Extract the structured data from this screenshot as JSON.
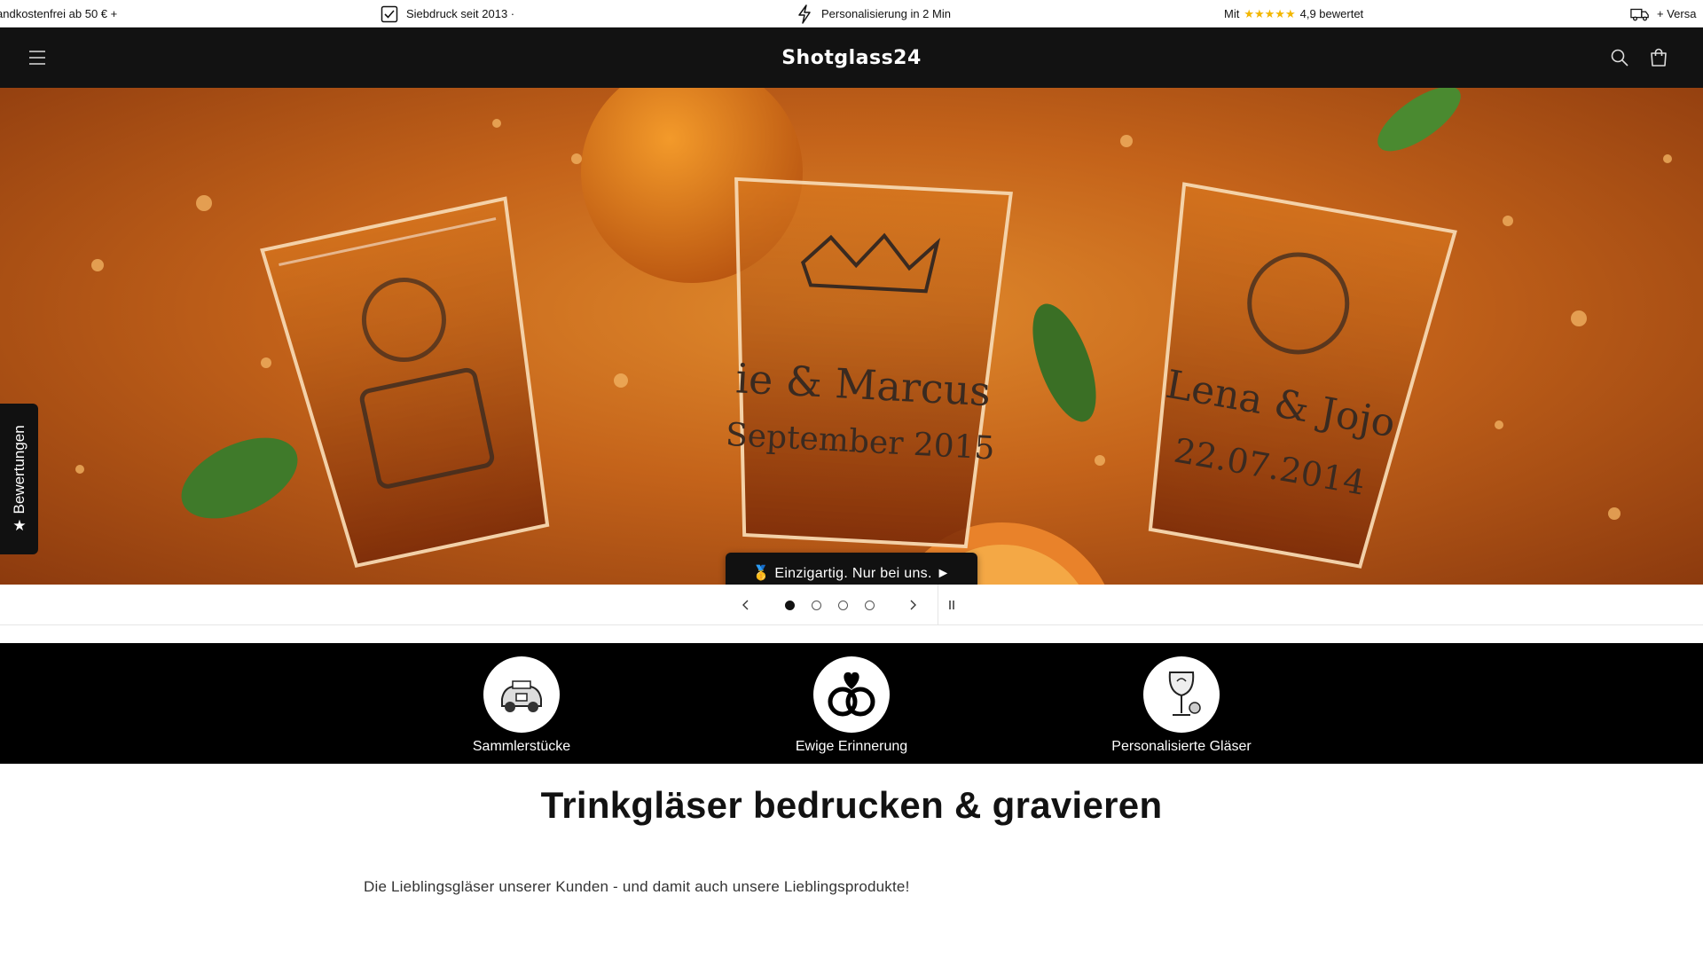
{
  "announcement": {
    "items": [
      {
        "text": "andkostenfrei ab 50 € +",
        "icon": "none"
      },
      {
        "text": "Siebdruck seit 2013 ·",
        "icon": "checkbox-icon"
      },
      {
        "text": "Personalisierung in 2 Min",
        "icon": "lightning-icon"
      },
      {
        "text_before": "Mit",
        "stars": "★★★★★",
        "text_after": "4,9 bewertet",
        "icon": "none"
      },
      {
        "text": "+ Versa",
        "icon": "truck-icon"
      }
    ]
  },
  "header": {
    "logo": "Shotglass24",
    "menu_icon": "hamburger-icon",
    "search_icon": "search-icon",
    "cart_icon": "bag-icon"
  },
  "hero": {
    "cta_label": "🥇 Einzigartig. Nur bei uns. ►",
    "glass_texts": [
      "ie & Marcus",
      "September 2015",
      "Lena & Jojo",
      "22.07.2014"
    ]
  },
  "reviews_tab": {
    "label": "Bewertungen",
    "icon": "star-icon"
  },
  "slider": {
    "slide_count": 4,
    "active_index": 0,
    "prev_icon": "chevron-left-icon",
    "next_icon": "chevron-right-icon",
    "pause_icon": "pause-icon"
  },
  "categories": [
    {
      "label": "Sammlerstücke",
      "icon": "car-illustration-icon"
    },
    {
      "label": "Ewige Erinnerung",
      "icon": "rings-heart-icon"
    },
    {
      "label": "Personalisierte Gläser",
      "icon": "wine-glass-icon"
    }
  ],
  "content": {
    "title": "Trinkgläser bedrucken & gravieren",
    "description": "Die Lieblingsgläser unserer Kunden - und damit auch unsere Lieblingsprodukte!"
  },
  "colors": {
    "header_bg": "#121212",
    "star": "#f2b600",
    "hero_orange": "#c4631a",
    "category_bg": "#000000"
  }
}
